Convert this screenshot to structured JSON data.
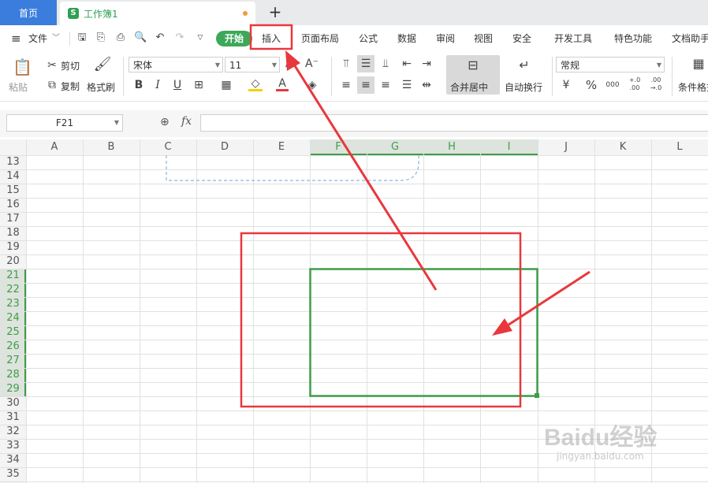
{
  "tabs": {
    "home": "首页",
    "workbook": "工作簿1",
    "workbook_icon": "S"
  },
  "menu": {
    "file": "文件",
    "start": "开始",
    "insert": "插入",
    "page_layout": "页面布局",
    "formula": "公式",
    "data": "数据",
    "review": "审阅",
    "view": "视图",
    "security": "安全",
    "dev_tools": "开发工具",
    "features": "特色功能",
    "doc_helper": "文档助手"
  },
  "ribbon": {
    "paste": "粘贴",
    "cut": "剪切",
    "copy": "复制",
    "format_painter": "格式刷",
    "font_name": "宋体",
    "font_size": "11",
    "merge_center": "合并居中",
    "wrap_text": "自动换行",
    "number_format": "常规",
    "conditional_format": "条件格式",
    "bold": "B",
    "italic": "I",
    "underline": "U",
    "font_color_letter": "A",
    "percent": "%",
    "thousands": "000",
    "inc_dec": "+.0\n.00",
    "dec_dec": ".00\n→.0"
  },
  "formula_bar": {
    "cell_ref": "F21",
    "fx": "fx"
  },
  "grid": {
    "columns": [
      "A",
      "B",
      "C",
      "D",
      "E",
      "F",
      "G",
      "H",
      "I",
      "J",
      "K",
      "L"
    ],
    "rows": [
      "13",
      "14",
      "15",
      "16",
      "17",
      "18",
      "19",
      "20",
      "21",
      "22",
      "23",
      "24",
      "25",
      "26",
      "27",
      "28",
      "29",
      "30",
      "31",
      "32",
      "33",
      "34",
      "35"
    ],
    "selected_columns": [
      "F",
      "G",
      "H",
      "I"
    ],
    "selected_rows": [
      "21",
      "22",
      "23",
      "24",
      "25",
      "26",
      "27",
      "28",
      "29"
    ]
  },
  "colors": {
    "accent_green": "#3ea85a",
    "selection_green": "#3f9d48",
    "annotation_red": "#e8383d",
    "tab_blue": "#3b7ddd",
    "dashed_blue": "#8ab4e0"
  },
  "watermark": {
    "brand": "Baidu经验",
    "url": "jingyan.baidu.com"
  }
}
